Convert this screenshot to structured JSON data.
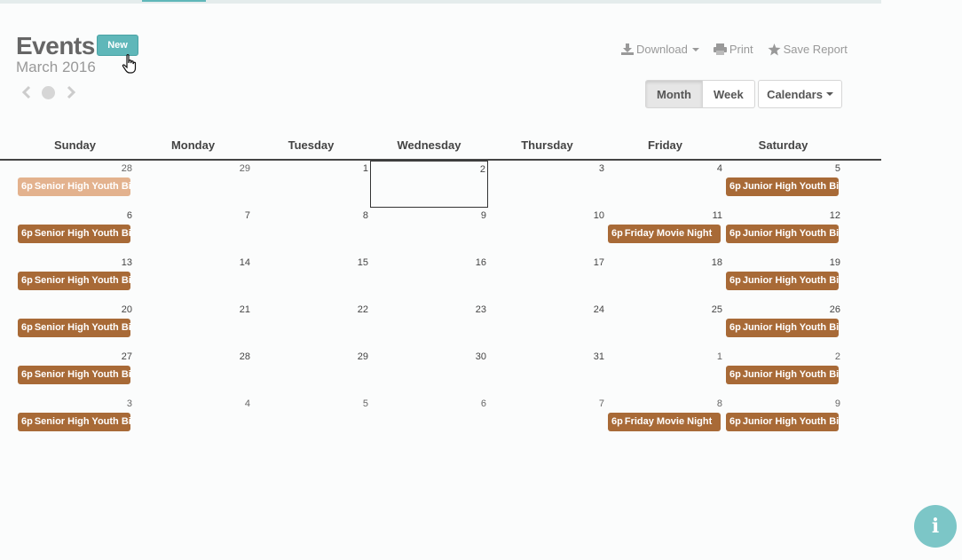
{
  "page": {
    "title": "Events",
    "new_label": "New",
    "month_label": "March 2016"
  },
  "actions": {
    "download": "Download",
    "print": "Print",
    "save_report": "Save Report"
  },
  "views": {
    "month": "Month",
    "week": "Week",
    "calendars": "Calendars"
  },
  "weekdays": [
    "Sunday",
    "Monday",
    "Tuesday",
    "Wednesday",
    "Thursday",
    "Friday",
    "Saturday"
  ],
  "weeks": [
    [
      "28",
      "29",
      "1",
      "2",
      "3",
      "4",
      "5"
    ],
    [
      "6",
      "7",
      "8",
      "9",
      "10",
      "11",
      "12"
    ],
    [
      "13",
      "14",
      "15",
      "16",
      "17",
      "18",
      "19"
    ],
    [
      "20",
      "21",
      "22",
      "23",
      "24",
      "25",
      "26"
    ],
    [
      "27",
      "28",
      "29",
      "30",
      "31",
      "1",
      "2"
    ],
    [
      "3",
      "4",
      "5",
      "6",
      "7",
      "8",
      "9"
    ]
  ],
  "other_month": [
    [
      0,
      0
    ],
    [
      0,
      1
    ],
    [
      4,
      5
    ],
    [
      4,
      6
    ],
    [
      5,
      0
    ],
    [
      5,
      1
    ],
    [
      5,
      2
    ],
    [
      5,
      3
    ],
    [
      5,
      4
    ],
    [
      5,
      5
    ],
    [
      5,
      6
    ]
  ],
  "today": [
    0,
    3
  ],
  "events": [
    {
      "week": 0,
      "day": 0,
      "time": "6p",
      "title": "Senior High Youth Bible Study",
      "past": true
    },
    {
      "week": 0,
      "day": 6,
      "time": "6p",
      "title": "Junior High Youth Bible Study",
      "past": false
    },
    {
      "week": 1,
      "day": 0,
      "time": "6p",
      "title": "Senior High Youth Bible Study",
      "past": false
    },
    {
      "week": 1,
      "day": 5,
      "time": "6p",
      "title": "Friday Movie Night",
      "past": false
    },
    {
      "week": 1,
      "day": 6,
      "time": "6p",
      "title": "Junior High Youth Bible Study",
      "past": false
    },
    {
      "week": 2,
      "day": 0,
      "time": "6p",
      "title": "Senior High Youth Bible Study",
      "past": false
    },
    {
      "week": 2,
      "day": 6,
      "time": "6p",
      "title": "Junior High Youth Bible Study",
      "past": false
    },
    {
      "week": 3,
      "day": 0,
      "time": "6p",
      "title": "Senior High Youth Bible Study",
      "past": false
    },
    {
      "week": 3,
      "day": 6,
      "time": "6p",
      "title": "Junior High Youth Bible Study",
      "past": false
    },
    {
      "week": 4,
      "day": 0,
      "time": "6p",
      "title": "Senior High Youth Bible Study",
      "past": false
    },
    {
      "week": 4,
      "day": 6,
      "time": "6p",
      "title": "Junior High Youth Bible Study",
      "past": false
    },
    {
      "week": 5,
      "day": 0,
      "time": "6p",
      "title": "Senior High Youth Bible Study",
      "past": false
    },
    {
      "week": 5,
      "day": 5,
      "time": "6p",
      "title": "Friday Movie Night",
      "past": false
    },
    {
      "week": 5,
      "day": 6,
      "time": "6p",
      "title": "Junior High Youth Bible Study",
      "past": false
    }
  ],
  "colors": {
    "accent": "#5fb7b9",
    "event": "#a86a37",
    "event_past": "#e3b28e",
    "info": "#7cc6c7"
  },
  "icons": {
    "info": "i"
  }
}
